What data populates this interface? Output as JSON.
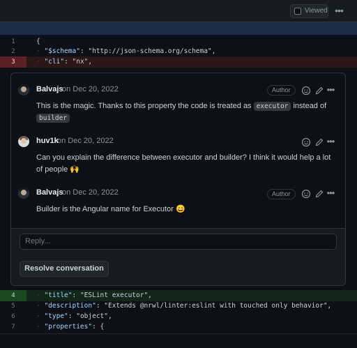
{
  "header": {
    "viewed_label": "Viewed",
    "more_icon": "kebab-horizontal-icon"
  },
  "diff_top": [
    {
      "num": "1",
      "type": "context",
      "code": "{"
    },
    {
      "num": "2",
      "type": "context",
      "key": "\"$schema\"",
      "rest": ": \"http://json-schema.org/schema\","
    },
    {
      "num": "3",
      "type": "removed",
      "key": "\"cli\"",
      "rest": ": \"nx\","
    }
  ],
  "thread": {
    "comments": [
      {
        "author": "Balvajs",
        "date": "on Dec 20, 2022",
        "badge": "Author",
        "body_pre": "This is the magic. Thanks to this property the code is treated as",
        "code1": "executor",
        "body_mid": "instead of",
        "code2": "builder"
      },
      {
        "author": "huv1k",
        "date": "on Dec 20, 2022",
        "body": "Can you explain the difference between executor and builder? I think it would help a lot of people 🙌"
      },
      {
        "author": "Balvajs",
        "date": "on Dec 20, 2022",
        "badge": "Author",
        "body": "Builder is the Angular name for Executor 😄"
      }
    ],
    "reply_placeholder": "Reply...",
    "resolve_label": "Resolve conversation"
  },
  "diff_bottom": [
    {
      "num": "4",
      "type": "added",
      "key": "\"title\"",
      "rest": ": \"ESLint executor\","
    },
    {
      "num": "5",
      "type": "context",
      "key": "\"description\"",
      "rest": ": \"Extends @nrwl/linter:eslint with touched only behavior\","
    },
    {
      "num": "6",
      "type": "context",
      "key": "\"type\"",
      "rest": ": \"object\","
    },
    {
      "num": "7",
      "type": "context",
      "key": "\"properties\"",
      "rest": ": {"
    }
  ],
  "colors": {
    "background": "#0d1117",
    "added_line": "#12261a",
    "removed_line": "#2b1618",
    "hunk_header": "#1c2d4a",
    "string": "#a5d6ff"
  }
}
